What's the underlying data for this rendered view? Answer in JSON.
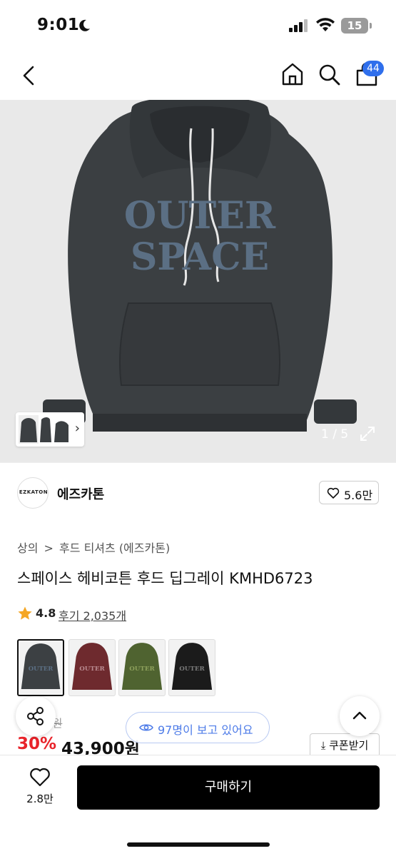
{
  "status_bar": {
    "time": "9:01",
    "battery": "15"
  },
  "nav": {
    "cart_count": "44"
  },
  "gallery": {
    "page_indicator": "1 / 5"
  },
  "brand": {
    "logo_text": "EZKATON",
    "name": "에즈카톤",
    "likes": "5.6만"
  },
  "breadcrumb": {
    "level1": "상의",
    "separator": ">",
    "level2": "후드 티셔츠 (에즈카톤)"
  },
  "product": {
    "title": "스페이스 헤비코튼 후드 딥그레이 KMHD6723",
    "rating": "4.8",
    "reviews": "후기 2,035개",
    "colors": [
      {
        "name": "deep-grey",
        "hex": "#3c4043"
      },
      {
        "name": "burgundy",
        "hex": "#6e2a2e"
      },
      {
        "name": "khaki",
        "hex": "#4f6330"
      },
      {
        "name": "black",
        "hex": "#1b1b1b"
      }
    ]
  },
  "price": {
    "original": "0원",
    "discount": "30%",
    "sale": "43,900원",
    "coupon_label": "쿠폰받기"
  },
  "overlay": {
    "viewers": "97명이 보고 있어요"
  },
  "bottom_bar": {
    "wish_count": "2.8만",
    "buy_label": "구매하기"
  },
  "colors": {
    "accent_blue": "#2f6fec",
    "discount_red": "#e8232a",
    "buy_black": "#000000"
  }
}
